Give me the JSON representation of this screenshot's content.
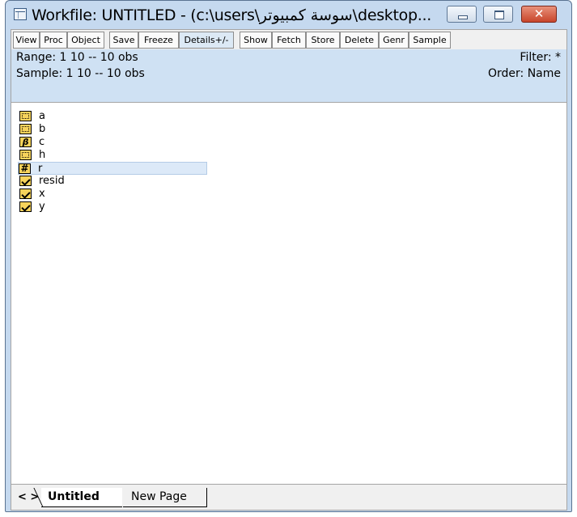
{
  "window": {
    "title": "Workfile: UNTITLED - (c:\\users\\سوسة كمبيوتر\\desktop...",
    "minimize_icon": "minimize-icon",
    "maximize_icon": "maximize-icon",
    "close_icon": "close-icon",
    "close_glyph": "✕"
  },
  "toolbar": {
    "buttons": [
      {
        "label": "View"
      },
      {
        "label": "Proc"
      },
      {
        "label": "Object"
      },
      {
        "label": "Save"
      },
      {
        "label": "Freeze"
      },
      {
        "label": "Details+/-"
      },
      {
        "label": "Show"
      },
      {
        "label": "Fetch"
      },
      {
        "label": "Store"
      },
      {
        "label": "Delete"
      },
      {
        "label": "Genr"
      },
      {
        "label": "Sample"
      }
    ]
  },
  "info": {
    "range": "Range:  1 10  --  10 obs",
    "sample": "Sample: 1 10  --  10 obs",
    "filter": "Filter: *",
    "order": "Order: Name"
  },
  "objects": [
    {
      "name": "a",
      "icon": "matrix-icon",
      "glyph": ""
    },
    {
      "name": "b",
      "icon": "matrix-icon",
      "glyph": ""
    },
    {
      "name": "c",
      "icon": "coefficient-icon",
      "glyph": "β"
    },
    {
      "name": "h",
      "icon": "matrix-icon",
      "glyph": ""
    },
    {
      "name": "r",
      "icon": "scalar-icon",
      "glyph": "#"
    },
    {
      "name": "resid",
      "icon": "series-icon",
      "glyph": ""
    },
    {
      "name": "x",
      "icon": "series-icon",
      "glyph": ""
    },
    {
      "name": "y",
      "icon": "series-icon",
      "glyph": ""
    }
  ],
  "tabs": {
    "nav": "< >",
    "active": "Untitled",
    "other": "New Page"
  }
}
